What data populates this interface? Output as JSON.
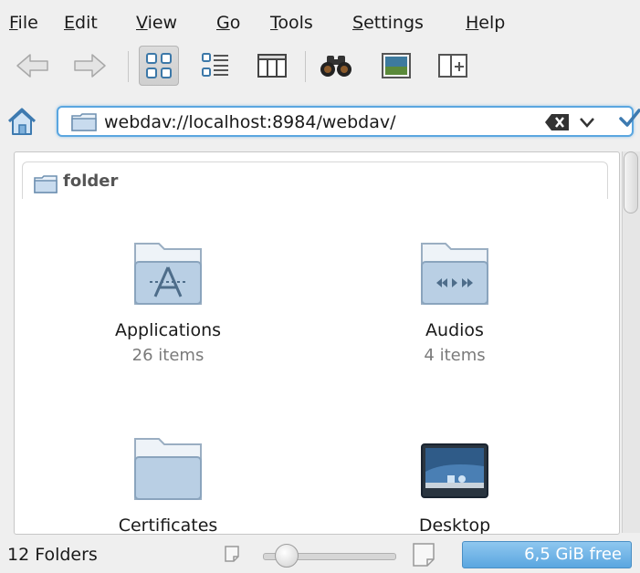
{
  "menubar": {
    "items": [
      {
        "mnemonic": "F",
        "rest": "ile"
      },
      {
        "mnemonic": "E",
        "rest": "dit"
      },
      {
        "mnemonic": "V",
        "rest": "iew"
      },
      {
        "mnemonic": "G",
        "rest": "o"
      },
      {
        "mnemonic": "T",
        "rest": "ools"
      },
      {
        "mnemonic": "S",
        "rest": "ettings"
      },
      {
        "mnemonic": "H",
        "rest": "elp"
      }
    ]
  },
  "toolbar": {
    "buttons": [
      "back-arrow-icon",
      "forward-arrow-icon",
      "icons-view-icon",
      "details-view-icon",
      "columns-view-icon",
      "binoculars-icon",
      "preview-icon",
      "split-view-icon"
    ],
    "active_view": "icons"
  },
  "location": {
    "url": "webdav://localhost:8984/webdav/"
  },
  "view": {
    "header_title": "folder",
    "items": [
      {
        "name": "Applications",
        "count": "26 items",
        "icon": "applications-folder-icon"
      },
      {
        "name": "Audios",
        "count": "4 items",
        "icon": "audio-folder-icon"
      },
      {
        "name": "Certificates",
        "count": "",
        "icon": "folder-icon"
      },
      {
        "name": "Desktop",
        "count": "",
        "icon": "desktop-folder-icon"
      }
    ]
  },
  "statusbar": {
    "summary": "12 Folders",
    "free_space": "6,5 GiB free",
    "zoom_level": 0.18
  },
  "colors": {
    "accent": "#5aa6e0",
    "folder": "#b9cfe4"
  }
}
